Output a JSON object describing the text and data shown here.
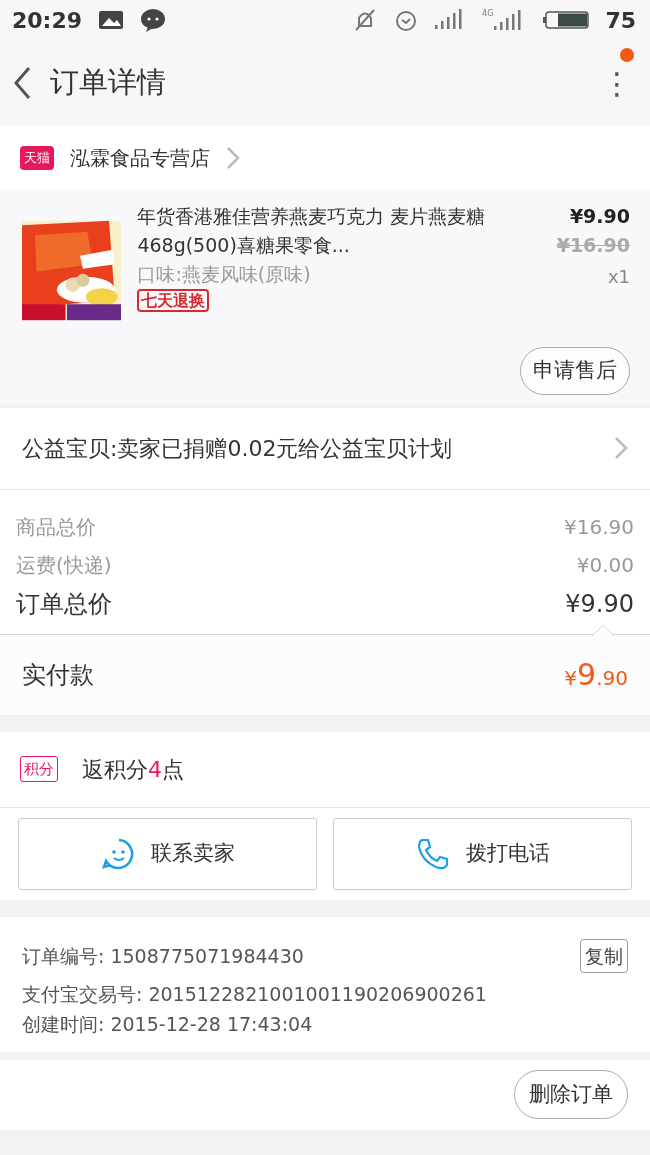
{
  "status_bar": {
    "time": "20:29",
    "battery_text": "75",
    "network": "4G"
  },
  "header": {
    "title": "订单详情",
    "menu": "⋮",
    "notification_dot": true
  },
  "store": {
    "badge": "天猫",
    "name": "泓霖食品专营店"
  },
  "product": {
    "kind": "picture",
    "title": "年货香港雅佳营养燕麦巧克力 麦片燕麦糖468g(500)喜糖果零食...",
    "variant": "口味:燕麦风味(原味)",
    "tag": "七天退换",
    "price": "¥9.90",
    "original_price": "¥16.90",
    "quantity": "x1",
    "after_sale_button": "申请售后"
  },
  "charity": {
    "text": "公益宝贝:卖家已捐赠0.02元给公益宝贝计划"
  },
  "summary": [
    {
      "label": "商品总价",
      "value": "¥16.90",
      "kind": "minor"
    },
    {
      "label": "运费(快递)",
      "value": "¥0.00",
      "kind": "minor"
    },
    {
      "label": "订单总价",
      "value": "¥9.90",
      "kind": "major"
    }
  ],
  "payment": {
    "label": "实付款",
    "currency": "¥",
    "integer": "9",
    "decimal": ".90"
  },
  "points": {
    "tag": "积分",
    "prefix": "返积分",
    "amount": "4",
    "suffix": "点"
  },
  "contact_buttons": [
    {
      "label": "联系卖家",
      "kind": "chat"
    },
    {
      "label": "拨打电话",
      "kind": "phone"
    }
  ],
  "order_info": {
    "copy_button": "复制",
    "lines": [
      {
        "label": "订单编号:",
        "value": "1508775071984430"
      },
      {
        "label": "支付宝交易号:",
        "value": "2015122821001001190206900261"
      },
      {
        "label": "创建时间:",
        "value": "2015-12-28 17:43:04"
      }
    ]
  },
  "bottom_bar": {
    "delete_button": "删除订单"
  }
}
